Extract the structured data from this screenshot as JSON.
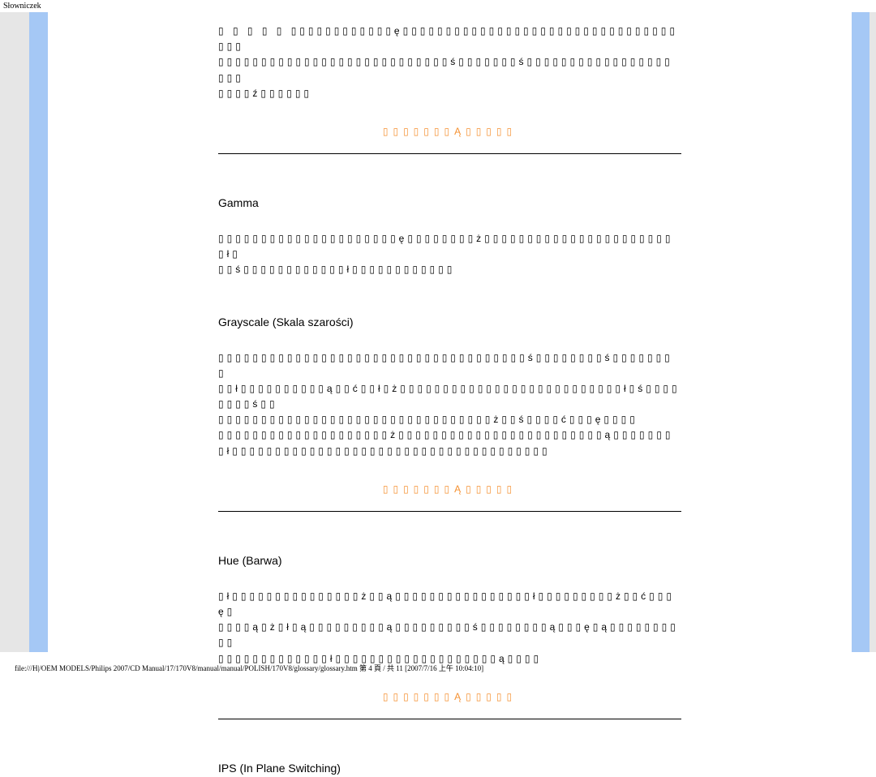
{
  "header": {
    "title": "Słowniczek"
  },
  "content": {
    "intro_para": "▯ ▯ ▯ ▯ ▯ ▯▯▯▯▯▯▯▯▯▯▯▯ę▯▯▯▯▯▯▯▯▯▯▯▯▯▯▯▯▯▯▯▯▯▯▯▯▯▯▯▯▯▯▯▯▯▯▯\n▯▯▯▯▯▯▯▯▯▯▯▯▯▯▯▯▯▯▯▯▯▯▯▯▯▯▯ś▯▯▯▯▯▯▯ś▯▯▯▯▯▯▯▯▯▯▯▯▯▯▯▯▯▯▯▯\n▯▯▯▯ź▯▯▯▯▯▯",
    "back_link_text": "▯▯▯▯▯▯▯Ą▯▯▯▯▯",
    "gamma": {
      "title": "Gamma",
      "body": "▯▯▯▯▯▯▯▯▯▯▯▯▯▯▯▯▯▯▯▯▯ę▯▯▯▯▯▯▯▯ż▯▯▯▯▯▯▯▯▯▯▯▯▯▯▯▯▯▯▯▯▯▯▯ł▯\n▯▯ś▯▯▯▯▯▯▯▯▯▯▯▯ł▯▯▯▯▯▯▯▯▯▯▯▯"
    },
    "grayscale": {
      "title": "Grayscale (Skala szarości)",
      "body": "▯▯▯▯▯▯▯▯▯▯▯▯▯▯▯▯▯▯▯▯▯▯▯▯▯▯▯▯▯▯▯▯▯▯▯▯ś▯▯▯▯▯▯▯▯ś▯▯▯▯▯▯▯▯\n▯▯ł▯▯▯▯▯▯▯▯▯▯ą▯▯ć▯▯ł▯ż▯▯▯▯▯▯▯▯▯▯▯▯▯▯▯▯▯▯▯▯▯▯▯▯▯▯ł▯ś▯▯▯▯▯▯▯▯ś▯▯\n▯▯▯▯▯▯▯▯▯▯▯▯▯▯▯▯▯▯▯▯▯▯▯▯▯▯▯▯▯▯▯▯ż▯▯ś▯▯▯▯ć▯▯▯ę▯▯▯▯\n▯▯▯▯▯▯▯▯▯▯▯▯▯▯▯▯▯▯▯▯ż▯▯▯▯▯▯▯▯▯▯▯▯▯▯▯▯▯▯▯▯▯▯▯▯ą▯▯▯▯▯▯▯\n▯ł▯▯▯▯▯▯▯▯▯▯▯▯▯▯▯▯▯▯▯▯▯▯▯▯▯▯▯▯▯▯▯▯▯▯▯▯▯"
    },
    "hue": {
      "title": "Hue (Barwa)",
      "body": "▯ł▯▯▯▯▯▯▯▯▯▯▯▯▯▯▯ż▯▯ą▯▯▯▯▯▯▯▯▯▯▯▯▯▯▯▯ł▯▯▯▯▯▯▯▯▯ż▯▯ć▯▯▯ę▯\n▯▯▯▯ą▯ż▯ł▯ą▯▯▯▯▯▯▯▯▯ą▯▯▯▯▯▯▯▯▯ś▯▯▯▯▯▯▯▯ą▯▯▯ę▯ą▯▯▯▯▯▯▯▯▯▯\n▯▯▯▯▯▯▯▯▯▯▯▯▯ł▯▯▯▯▯▯▯▯▯▯▯▯▯▯▯▯▯▯▯ą▯▯▯▯"
    },
    "ips": {
      "title": "IPS (In Plane Switching)"
    }
  },
  "footer": {
    "path": "file:///H|/OEM MODELS/Philips 2007/CD Manual/17/170V8/manual/manual/POLISH/170V8/glossary/glossary.htm 第 4 頁 / 共 11  [2007/7/16 上午 10:04:10]"
  }
}
